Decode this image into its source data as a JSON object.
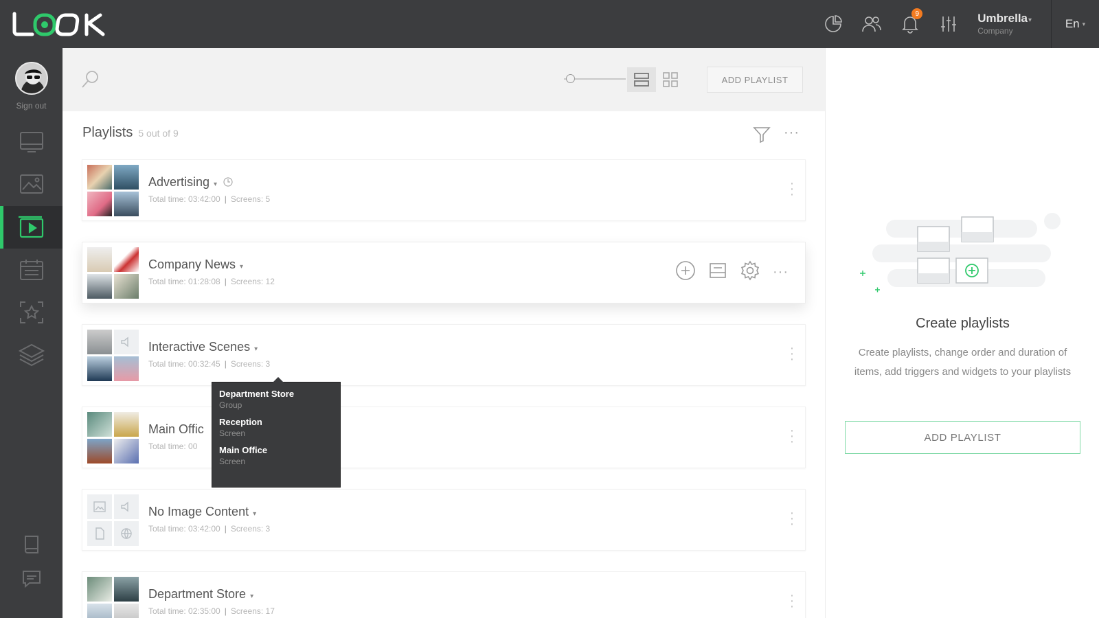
{
  "brand": {
    "logo": "LOOK",
    "accent": "#2fc96b"
  },
  "topbar": {
    "notifications_count": "9",
    "account_name": "Umbrella",
    "account_role": "Company",
    "language": "En",
    "icons": [
      "analytics-icon",
      "users-icon",
      "bell-icon",
      "settings-sliders-icon"
    ]
  },
  "sidebar": {
    "signout_label": "Sign out",
    "items": [
      "screens-icon",
      "media-icon",
      "playlists-icon",
      "schedule-icon",
      "widgets-icon",
      "layers-icon",
      "help-book-icon",
      "chat-icon"
    ],
    "active": "playlists-icon"
  },
  "toolbar": {
    "search_icon": "search-icon",
    "add_playlist_label": "ADD PLAYLIST",
    "zoom_level": 0.1
  },
  "list": {
    "title": "Playlists",
    "count": "5 out of 9"
  },
  "playlists": [
    {
      "name": "Advertising",
      "total_time": "Total time: 03:42:00",
      "screens": "Screens: 5"
    },
    {
      "name": "Company News",
      "total_time": "Total time: 01:28:08",
      "screens": "Screens: 12"
    },
    {
      "name": "Interactive Scenes",
      "total_time": "Total time: 00:32:45",
      "screens": "Screens: 3"
    },
    {
      "name": "Main Offic",
      "total_time": "Total time: 00",
      "screens": ""
    },
    {
      "name": "No Image Content",
      "total_time": "Total time: 03:42:00",
      "screens": "Screens: 3"
    },
    {
      "name": "Department Store",
      "total_time": "Total time: 02:35:00",
      "screens": "Screens: 17"
    }
  ],
  "tooltip": [
    {
      "name": "Department Store",
      "type": "Group"
    },
    {
      "name": "Reception",
      "type": "Screen"
    },
    {
      "name": "Main Office",
      "type": "Screen"
    }
  ],
  "empty_state": {
    "title": "Create playlists",
    "description": "Create playlists, change order and duration of items, add triggers and widgets to your playlists",
    "button_label": "ADD PLAYLIST"
  }
}
